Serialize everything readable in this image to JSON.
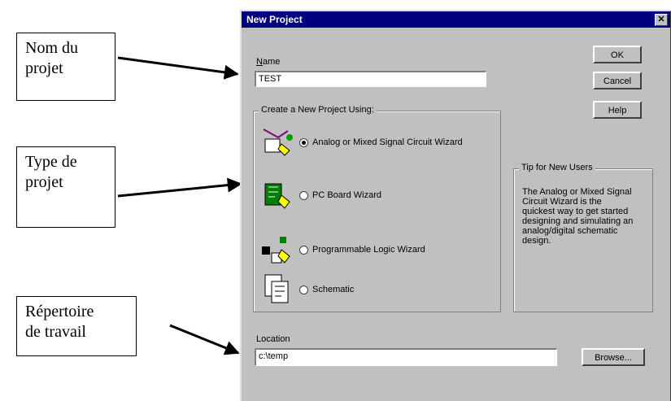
{
  "callouts": {
    "name": [
      "Nom du",
      "projet"
    ],
    "type": [
      "Type de",
      "projet"
    ],
    "dir": [
      "Répertoire",
      "de travail"
    ]
  },
  "dialog": {
    "title": "New Project",
    "close_glyph": "✕",
    "name_label_key": "N",
    "name_label_rest": "ame",
    "name_value": "TEST",
    "ok_label": "OK",
    "cancel_label": "Cancel",
    "help_label": "Help",
    "group_title": "Create a New Project Using:",
    "options": [
      {
        "label": "Analog or Mixed Signal Circuit Wizard",
        "checked": true,
        "icon": "analog-wizard-icon"
      },
      {
        "label": "PC Board Wizard",
        "checked": false,
        "icon": "pc-board-icon"
      },
      {
        "label": "Programmable Logic Wizard",
        "checked": false,
        "icon": "programmable-logic-icon"
      },
      {
        "label": "Schematic",
        "checked": false,
        "icon": "schematic-icon"
      }
    ],
    "tip_title": "Tip for New Users",
    "tip_text": [
      "The Analog or Mixed Signal",
      "Circuit Wizard is the",
      "quickest way to get started",
      "designing and simulating an",
      "analog/digital schematic",
      "design."
    ],
    "location_label": "Location",
    "location_value": "c:\\temp",
    "browse_label": "Browse..."
  },
  "colors": {
    "titlebar": "#000080",
    "face": "#c0c0c0"
  }
}
